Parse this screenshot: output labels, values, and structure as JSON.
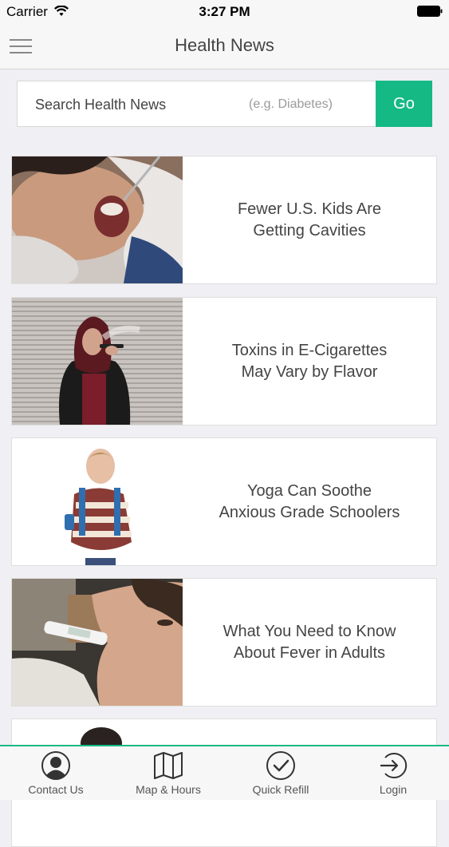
{
  "status_bar": {
    "carrier": "Carrier",
    "time": "3:27 PM"
  },
  "nav": {
    "title": "Health News",
    "menu_icon": "hamburger-menu-icon"
  },
  "search": {
    "label": "Search Health News",
    "placeholder": "(e.g. Diabetes)",
    "go_label": "Go"
  },
  "articles": [
    {
      "title": "Fewer U.S. Kids Are\nGetting Cavities"
    },
    {
      "title": "Toxins in E-Cigarettes\nMay Vary by Flavor"
    },
    {
      "title": "Yoga Can Soothe\nAnxious Grade Schoolers"
    },
    {
      "title": "What You Need to Know\nAbout Fever in Adults"
    }
  ],
  "tabs": [
    {
      "label": "Contact Us",
      "icon": "contact-person-icon"
    },
    {
      "label": "Map & Hours",
      "icon": "folded-map-icon"
    },
    {
      "label": "Quick Refill",
      "icon": "checkmark-circle-icon"
    },
    {
      "label": "Login",
      "icon": "login-arrow-icon"
    }
  ],
  "colors": {
    "accent": "#15b983",
    "background": "#efeff4",
    "bar": "#f7f7f7"
  }
}
